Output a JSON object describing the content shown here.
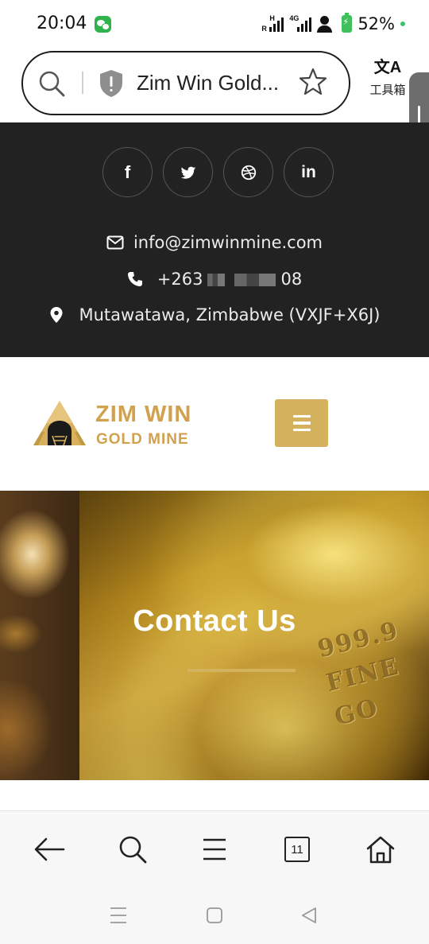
{
  "status_bar": {
    "time": "20:04",
    "signal1_label": "H",
    "signal1_sub": "R",
    "signal2_label": "4G",
    "battery": "52%"
  },
  "browser": {
    "address_text": "Zim Win Gold...",
    "translate_glyph": "文A",
    "translate_label": "工具箱",
    "tab_count": "11"
  },
  "info_bar": {
    "social": [
      "facebook-icon",
      "twitter-icon",
      "dribbble-icon",
      "linkedin-icon"
    ],
    "linkedin_text": "in",
    "facebook_text": "f",
    "email": "info@zimwinmine.com",
    "phone_prefix": "+263",
    "phone_suffix": "08",
    "address": "Mutawatawa, Zimbabwe (VXJF+X6J)"
  },
  "logo": {
    "line1": "ZIM WIN",
    "line2": "GOLD MINE"
  },
  "hero": {
    "title": "Contact Us",
    "engraving": "999.9\nFINE\nGO"
  },
  "colors": {
    "gold_accent": "#d4b15d",
    "logo_gold": "#d1a14f",
    "dark_bar": "#222222"
  }
}
